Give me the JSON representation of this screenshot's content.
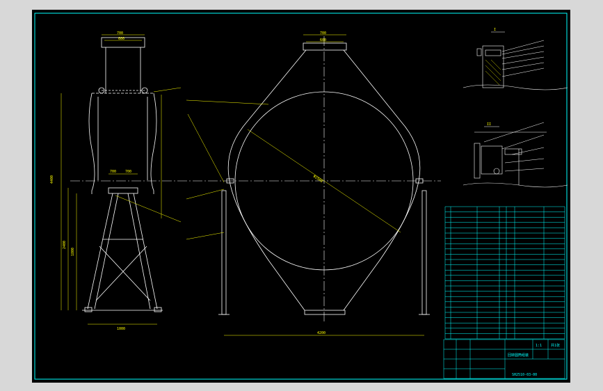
{
  "title_block": {
    "drawing_number": "SH2510-03-00",
    "drawing_name": "回转圆筒组装",
    "scale_label": "1:1",
    "sheet_label": "共1张"
  },
  "views": {
    "side": {
      "top_dim_outer": "700",
      "top_dim_inner": "600",
      "mid_dim_left": "700",
      "mid_dim_right": "700",
      "bottom_dim": "1000",
      "height_total": "4400",
      "height_mid": "2400",
      "height_lower": "1800"
    },
    "front": {
      "top_dim_outer": "700",
      "top_dim_inner": "600",
      "bottom_dim": "4200",
      "diameter_label": "Φ2500"
    },
    "detail_top": {
      "view_label": "I"
    },
    "detail_bottom": {
      "view_label": "II"
    }
  },
  "colors": {
    "frame": "#00ffff",
    "drawing": "#ffffff",
    "leader": "#ffff00",
    "background": "#000000"
  }
}
